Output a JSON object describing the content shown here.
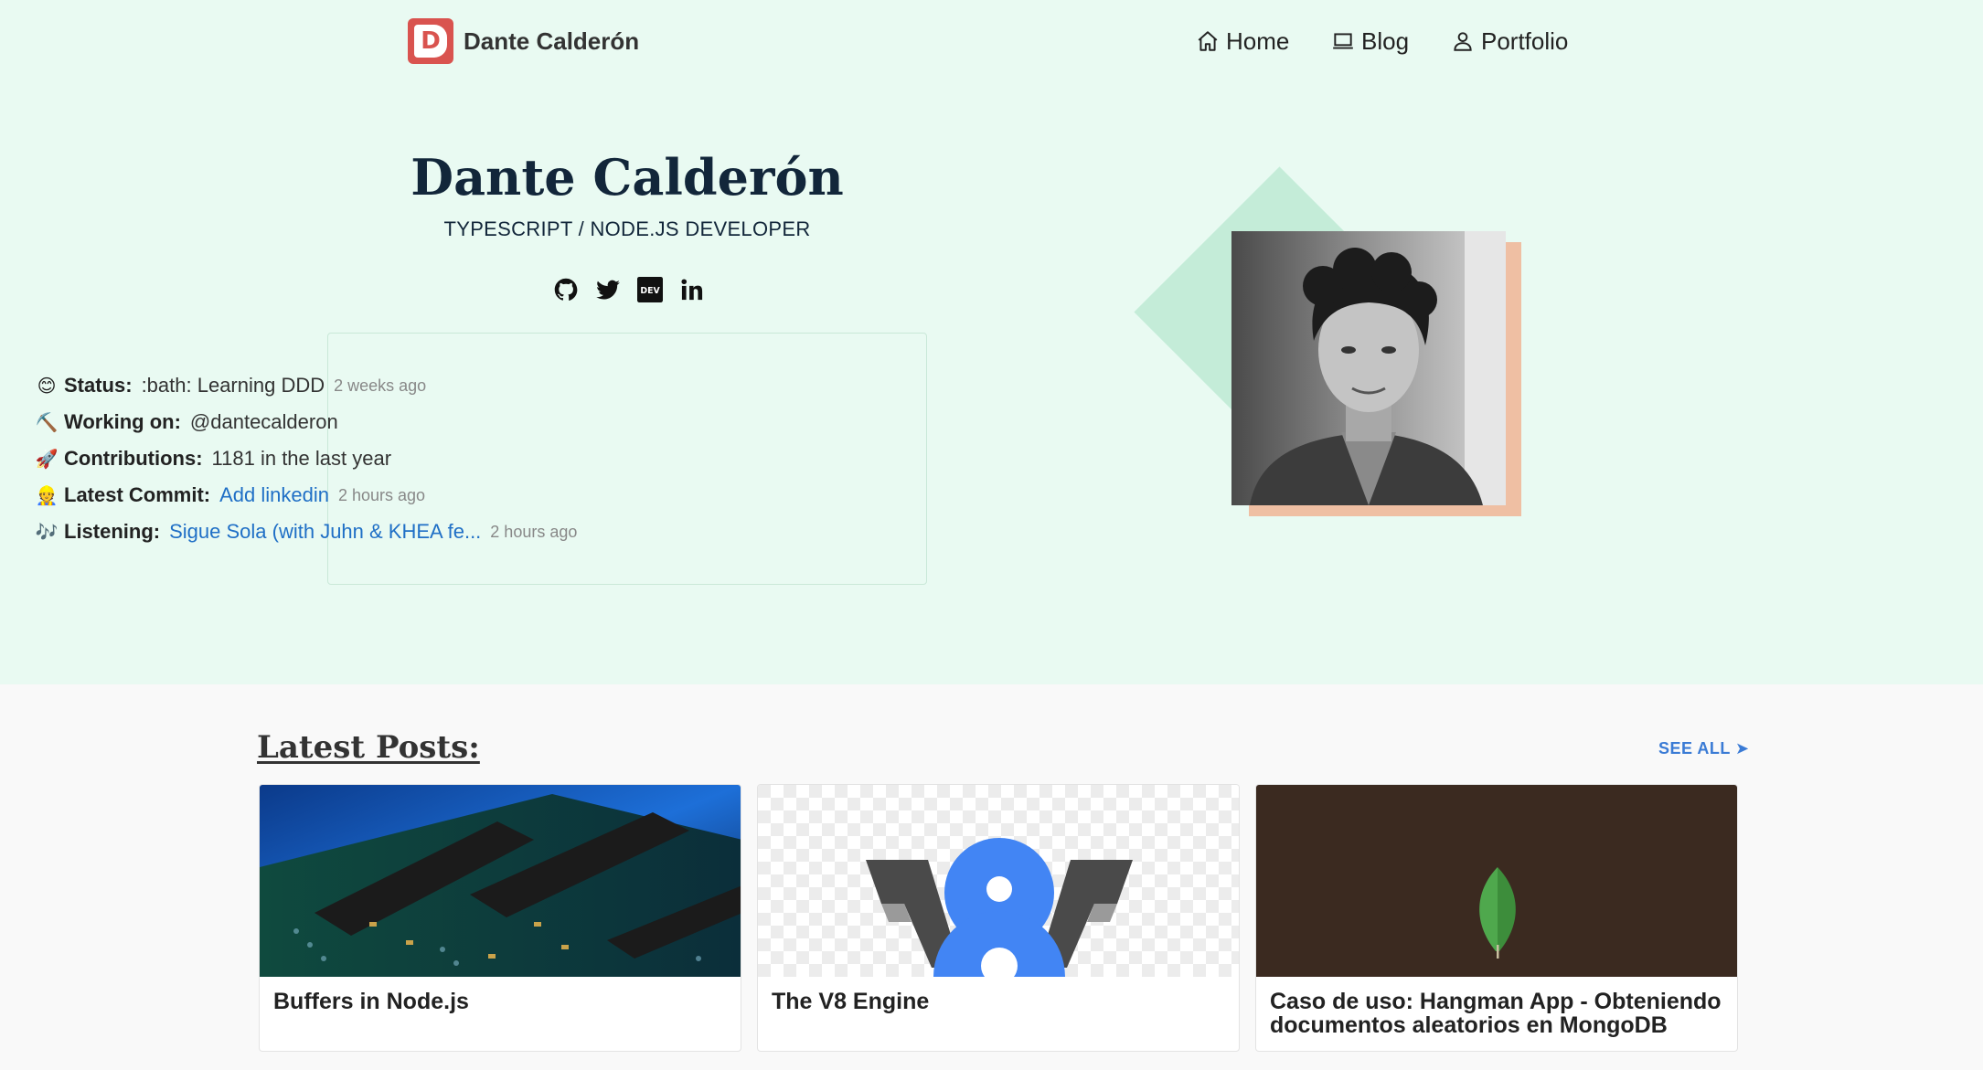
{
  "nav": {
    "logo_letter": "D",
    "brand": "Dante Calderón",
    "links": [
      {
        "label": "Home",
        "icon": "home-icon"
      },
      {
        "label": "Blog",
        "icon": "laptop-icon"
      },
      {
        "label": "Portfolio",
        "icon": "user-icon"
      }
    ]
  },
  "hero": {
    "name": "Dante Calderón",
    "role": "TYPESCRIPT / NODE.JS DEVELOPER",
    "socials": [
      "github-icon",
      "twitter-icon",
      "dev-icon",
      "linkedin-icon"
    ],
    "dev_label": "DEV",
    "status": [
      {
        "emoji": "😊",
        "label": "Status:",
        "value": ":bath: Learning DDD",
        "time": "2 weeks ago"
      },
      {
        "emoji": "⛏️",
        "label": "Working on:",
        "value": "@dantecalderon",
        "time": ""
      },
      {
        "emoji": "🚀",
        "label": "Contributions:",
        "value": "1181 in the last year",
        "time": ""
      },
      {
        "emoji": "👷",
        "label": "Latest Commit:",
        "value": "Add linkedin",
        "time": "2 hours ago"
      },
      {
        "emoji": "🎶",
        "label": "Listening:",
        "value": "Sigue Sola (with Juhn & KHEA fe...",
        "time": "2 hours ago"
      }
    ]
  },
  "posts": {
    "heading": "Latest Posts:",
    "see_all": "SEE ALL ➤",
    "items": [
      {
        "title": "Buffers in Node.js",
        "thumb": "circuit-board-image"
      },
      {
        "title": "The V8 Engine",
        "thumb": "v8-logo-image"
      },
      {
        "title": "Caso de uso: Hangman App - Obteniendo documentos aleatorios en MongoDB",
        "thumb": "mongodb-leaf-image"
      }
    ]
  },
  "colors": {
    "hero_bg": "#e9faf2",
    "accent_link": "#1f6fc6",
    "logo_red": "#d9534f",
    "diamond": "#c4ecd8",
    "photo_shadow": "#efbfa3"
  }
}
